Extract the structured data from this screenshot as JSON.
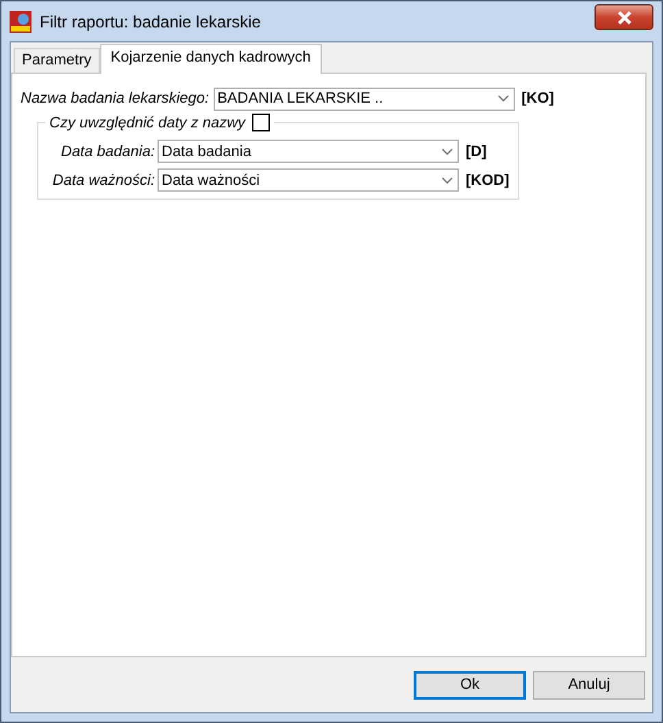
{
  "window": {
    "title": "Filtr raportu: badanie lekarskie"
  },
  "tabs": [
    {
      "label": "Parametry",
      "selected": false
    },
    {
      "label": "Kojarzenie danych kadrowych",
      "selected": true
    }
  ],
  "main_field": {
    "label": "Nazwa badania lekarskiego:",
    "value": "BADANIA LEKARSKIE ..",
    "code": "[KO]"
  },
  "group": {
    "label": "Czy uwzględnić daty z nazwy",
    "checked": false,
    "fields": [
      {
        "label": "Data badania:",
        "value": "Data badania",
        "code": "[D]"
      },
      {
        "label": "Data ważności:",
        "value": "Data ważności",
        "code": "[KOD]"
      }
    ]
  },
  "buttons": [
    {
      "label": "Ok",
      "default": true
    },
    {
      "label": "Anuluj",
      "default": false
    }
  ]
}
